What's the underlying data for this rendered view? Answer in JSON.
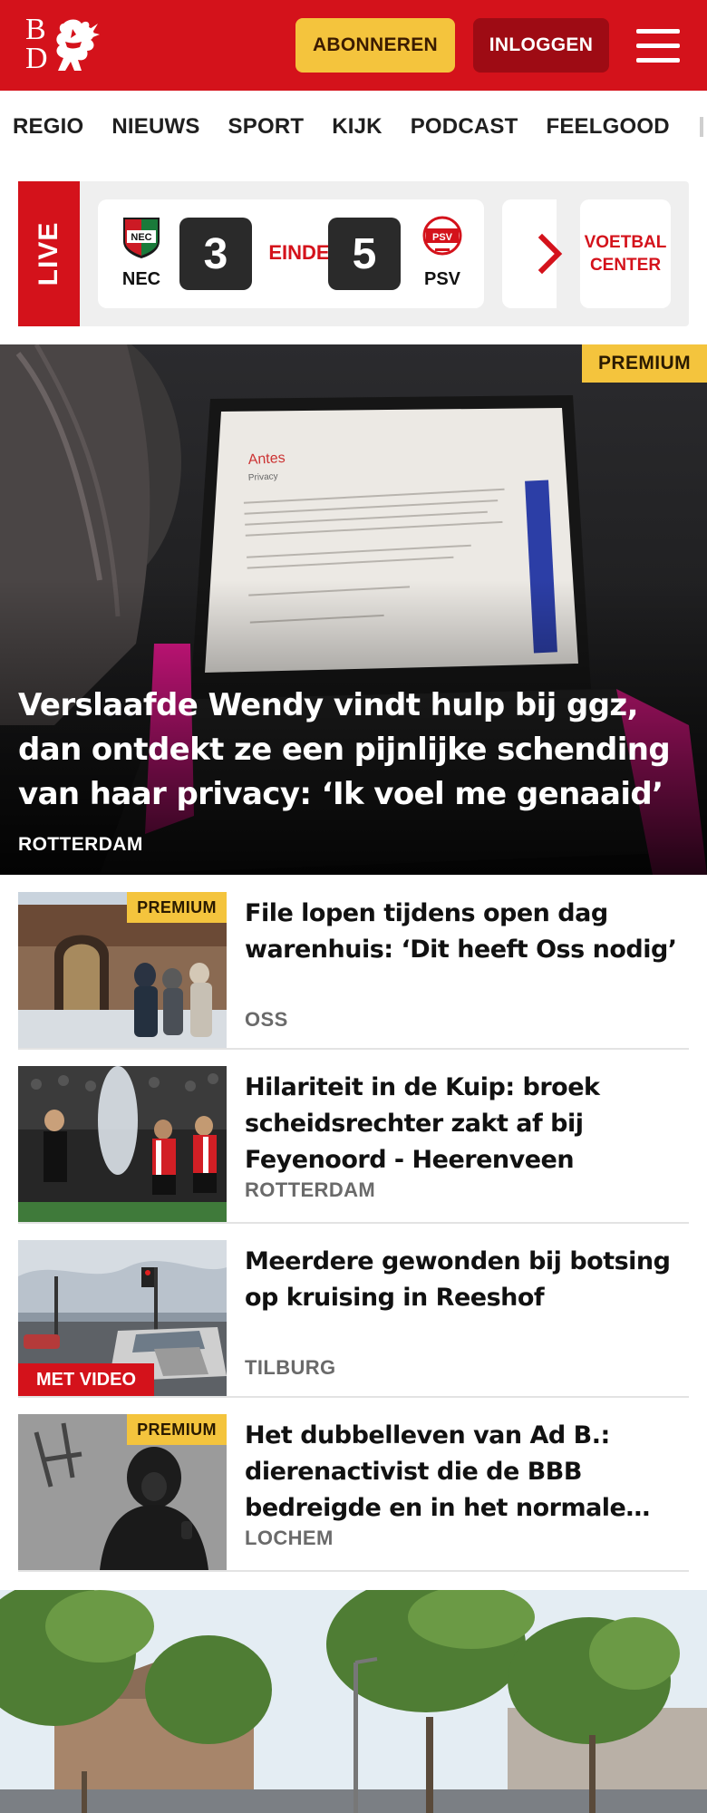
{
  "header": {
    "logo_b": "B",
    "logo_d": "D",
    "subscribe_label": "ABONNEREN",
    "login_label": "INLOGGEN",
    "menu_icon": "hamburger-icon",
    "brand_color": "#d4121b"
  },
  "nav": {
    "items": [
      "REGIO",
      "NIEUWS",
      "SPORT",
      "KIJK",
      "PODCAST",
      "FEELGOOD"
    ]
  },
  "live": {
    "label": "LIVE",
    "match": {
      "home_team": "NEC",
      "home_score": "3",
      "status": "EINDE",
      "away_score": "5",
      "away_team": "PSV"
    },
    "next_icon": "chevron-right-icon",
    "center_link": "VOETBAL CENTER"
  },
  "hero": {
    "badge": "PREMIUM",
    "title": "Verslaafde Wendy vindt hulp bij ggz, dan ontdekt ze een pijnlijke schending van haar privacy: ‘Ik voel me genaaid’",
    "location": "ROTTERDAM",
    "screen_heading": "Antes",
    "screen_subheading": "Privacy"
  },
  "articles": [
    {
      "badge": "PREMIUM",
      "title": "File lopen tijdens open dag warenhuis: ‘Dit heeft Oss nodig’",
      "location": "OSS"
    },
    {
      "title": "Hilariteit in de Kuip: broek scheidsrechter zakt af bij Feyenoord - Heerenveen",
      "location": "ROTTERDAM"
    },
    {
      "video_badge": "MET VIDEO",
      "title": "Meerdere gewonden bij botsing op kruising in Reeshof",
      "location": "TILBURG"
    },
    {
      "badge": "PREMIUM",
      "title": "Het dubbelleven van Ad B.: dierenactivist die de BBB bedreigde en in het normale…",
      "location": "LOCHEM"
    }
  ],
  "colors": {
    "premium": "#f4c43d",
    "accent_red": "#d4121b",
    "dark_red": "#9e0b14"
  }
}
